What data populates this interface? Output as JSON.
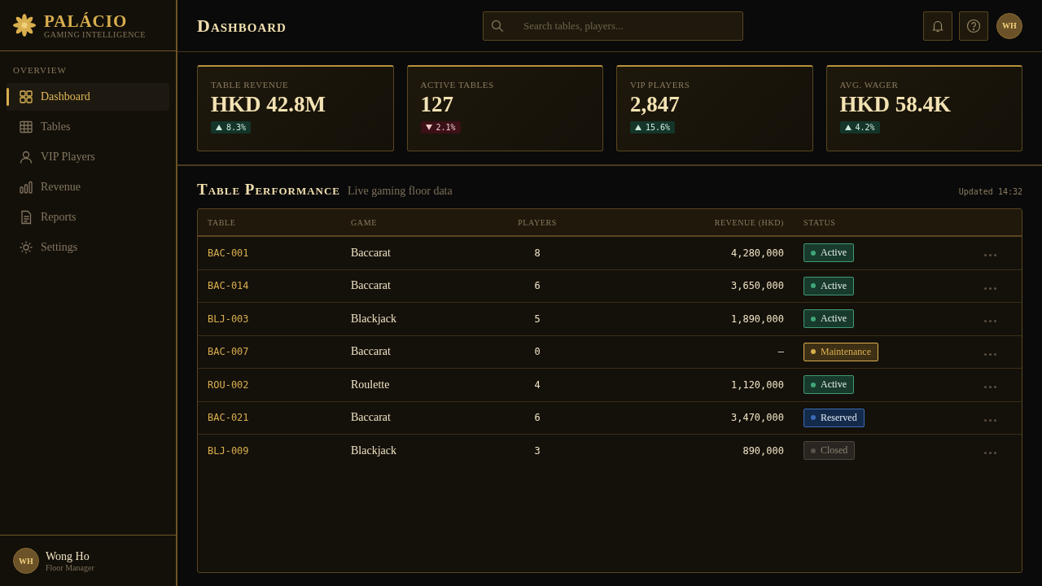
{
  "brand": {
    "name": "PALÁCIO",
    "tagline": "GAMING INTELLIGENCE"
  },
  "sidebar": {
    "section": "OVERVIEW",
    "items": [
      {
        "label": "Dashboard",
        "selected": true
      },
      {
        "label": "Tables",
        "selected": false
      },
      {
        "label": "VIP Players",
        "selected": false
      },
      {
        "label": "Revenue",
        "selected": false
      },
      {
        "label": "Reports",
        "selected": false
      },
      {
        "label": "Settings",
        "selected": false
      }
    ],
    "user": {
      "initials": "WH",
      "name": "Wong Ho",
      "role": "Floor Manager"
    }
  },
  "header": {
    "title": "Dashboard",
    "search": {
      "placeholder": "Search tables, players..."
    },
    "avatar": "WH"
  },
  "stats": [
    {
      "label": "TABLE REVENUE",
      "value": "HKD 42.8M",
      "change": "8.3%",
      "kind": "up"
    },
    {
      "label": "ACTIVE TABLES",
      "value": "127",
      "change": "2.1%",
      "kind": "down"
    },
    {
      "label": "VIP PLAYERS",
      "value": "2,847",
      "change": "15.6%",
      "kind": "up"
    },
    {
      "label": "AVG. WAGER",
      "value": "HKD 58.4K",
      "change": "4.2%",
      "kind": "up"
    }
  ],
  "performance": {
    "title": "Table Performance",
    "subtitle": "Live gaming floor data",
    "updated": "Updated 14:32",
    "columns": [
      "TABLE",
      "GAME",
      "PLAYERS",
      "REVENUE (HKD)",
      "STATUS"
    ],
    "rows": [
      {
        "table": "BAC-001",
        "game": "Baccarat",
        "players": "8",
        "revenue": "4,280,000",
        "status": "Active",
        "kind": "active"
      },
      {
        "table": "BAC-014",
        "game": "Baccarat",
        "players": "6",
        "revenue": "3,650,000",
        "status": "Active",
        "kind": "active"
      },
      {
        "table": "BLJ-003",
        "game": "Blackjack",
        "players": "5",
        "revenue": "1,890,000",
        "status": "Active",
        "kind": "active"
      },
      {
        "table": "BAC-007",
        "game": "Baccarat",
        "players": "0",
        "revenue": "–",
        "status": "Maintenance",
        "kind": "maintenance"
      },
      {
        "table": "ROU-002",
        "game": "Roulette",
        "players": "4",
        "revenue": "1,120,000",
        "status": "Active",
        "kind": "active"
      },
      {
        "table": "BAC-021",
        "game": "Baccarat",
        "players": "6",
        "revenue": "3,470,000",
        "status": "Reserved",
        "kind": "reserved"
      },
      {
        "table": "BLJ-009",
        "game": "Blackjack",
        "players": "3",
        "revenue": "890,000",
        "status": "Closed",
        "kind": "closed"
      }
    ]
  }
}
